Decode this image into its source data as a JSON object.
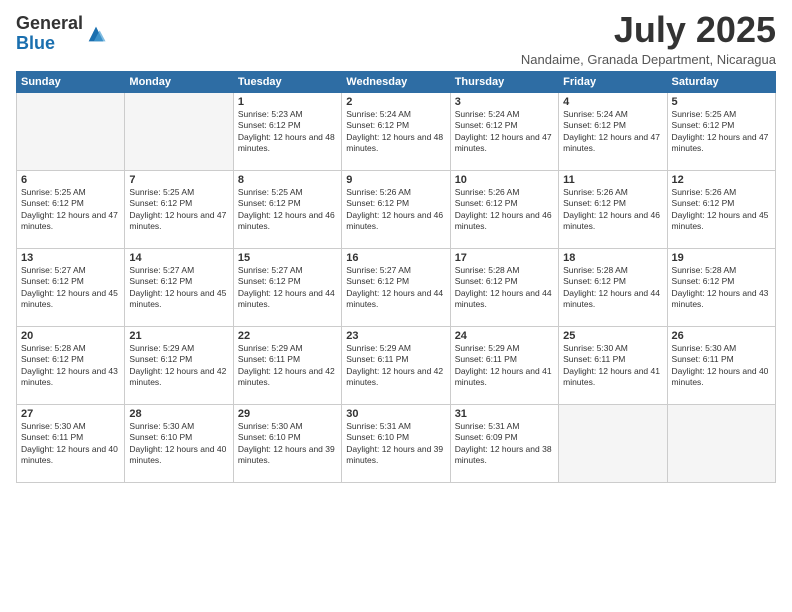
{
  "logo": {
    "general": "General",
    "blue": "Blue"
  },
  "header": {
    "month": "July 2025",
    "location": "Nandaime, Granada Department, Nicaragua"
  },
  "weekdays": [
    "Sunday",
    "Monday",
    "Tuesday",
    "Wednesday",
    "Thursday",
    "Friday",
    "Saturday"
  ],
  "weeks": [
    [
      {
        "day": "",
        "empty": true
      },
      {
        "day": "",
        "empty": true
      },
      {
        "day": "1",
        "sunrise": "5:23 AM",
        "sunset": "6:12 PM",
        "daylight": "12 hours and 48 minutes."
      },
      {
        "day": "2",
        "sunrise": "5:24 AM",
        "sunset": "6:12 PM",
        "daylight": "12 hours and 48 minutes."
      },
      {
        "day": "3",
        "sunrise": "5:24 AM",
        "sunset": "6:12 PM",
        "daylight": "12 hours and 47 minutes."
      },
      {
        "day": "4",
        "sunrise": "5:24 AM",
        "sunset": "6:12 PM",
        "daylight": "12 hours and 47 minutes."
      },
      {
        "day": "5",
        "sunrise": "5:25 AM",
        "sunset": "6:12 PM",
        "daylight": "12 hours and 47 minutes."
      }
    ],
    [
      {
        "day": "6",
        "sunrise": "5:25 AM",
        "sunset": "6:12 PM",
        "daylight": "12 hours and 47 minutes."
      },
      {
        "day": "7",
        "sunrise": "5:25 AM",
        "sunset": "6:12 PM",
        "daylight": "12 hours and 47 minutes."
      },
      {
        "day": "8",
        "sunrise": "5:25 AM",
        "sunset": "6:12 PM",
        "daylight": "12 hours and 46 minutes."
      },
      {
        "day": "9",
        "sunrise": "5:26 AM",
        "sunset": "6:12 PM",
        "daylight": "12 hours and 46 minutes."
      },
      {
        "day": "10",
        "sunrise": "5:26 AM",
        "sunset": "6:12 PM",
        "daylight": "12 hours and 46 minutes."
      },
      {
        "day": "11",
        "sunrise": "5:26 AM",
        "sunset": "6:12 PM",
        "daylight": "12 hours and 46 minutes."
      },
      {
        "day": "12",
        "sunrise": "5:26 AM",
        "sunset": "6:12 PM",
        "daylight": "12 hours and 45 minutes."
      }
    ],
    [
      {
        "day": "13",
        "sunrise": "5:27 AM",
        "sunset": "6:12 PM",
        "daylight": "12 hours and 45 minutes."
      },
      {
        "day": "14",
        "sunrise": "5:27 AM",
        "sunset": "6:12 PM",
        "daylight": "12 hours and 45 minutes."
      },
      {
        "day": "15",
        "sunrise": "5:27 AM",
        "sunset": "6:12 PM",
        "daylight": "12 hours and 44 minutes."
      },
      {
        "day": "16",
        "sunrise": "5:27 AM",
        "sunset": "6:12 PM",
        "daylight": "12 hours and 44 minutes."
      },
      {
        "day": "17",
        "sunrise": "5:28 AM",
        "sunset": "6:12 PM",
        "daylight": "12 hours and 44 minutes."
      },
      {
        "day": "18",
        "sunrise": "5:28 AM",
        "sunset": "6:12 PM",
        "daylight": "12 hours and 44 minutes."
      },
      {
        "day": "19",
        "sunrise": "5:28 AM",
        "sunset": "6:12 PM",
        "daylight": "12 hours and 43 minutes."
      }
    ],
    [
      {
        "day": "20",
        "sunrise": "5:28 AM",
        "sunset": "6:12 PM",
        "daylight": "12 hours and 43 minutes."
      },
      {
        "day": "21",
        "sunrise": "5:29 AM",
        "sunset": "6:12 PM",
        "daylight": "12 hours and 42 minutes."
      },
      {
        "day": "22",
        "sunrise": "5:29 AM",
        "sunset": "6:11 PM",
        "daylight": "12 hours and 42 minutes."
      },
      {
        "day": "23",
        "sunrise": "5:29 AM",
        "sunset": "6:11 PM",
        "daylight": "12 hours and 42 minutes."
      },
      {
        "day": "24",
        "sunrise": "5:29 AM",
        "sunset": "6:11 PM",
        "daylight": "12 hours and 41 minutes."
      },
      {
        "day": "25",
        "sunrise": "5:30 AM",
        "sunset": "6:11 PM",
        "daylight": "12 hours and 41 minutes."
      },
      {
        "day": "26",
        "sunrise": "5:30 AM",
        "sunset": "6:11 PM",
        "daylight": "12 hours and 40 minutes."
      }
    ],
    [
      {
        "day": "27",
        "sunrise": "5:30 AM",
        "sunset": "6:11 PM",
        "daylight": "12 hours and 40 minutes."
      },
      {
        "day": "28",
        "sunrise": "5:30 AM",
        "sunset": "6:10 PM",
        "daylight": "12 hours and 40 minutes."
      },
      {
        "day": "29",
        "sunrise": "5:30 AM",
        "sunset": "6:10 PM",
        "daylight": "12 hours and 39 minutes."
      },
      {
        "day": "30",
        "sunrise": "5:31 AM",
        "sunset": "6:10 PM",
        "daylight": "12 hours and 39 minutes."
      },
      {
        "day": "31",
        "sunrise": "5:31 AM",
        "sunset": "6:09 PM",
        "daylight": "12 hours and 38 minutes."
      },
      {
        "day": "",
        "empty": true
      },
      {
        "day": "",
        "empty": true
      }
    ]
  ]
}
